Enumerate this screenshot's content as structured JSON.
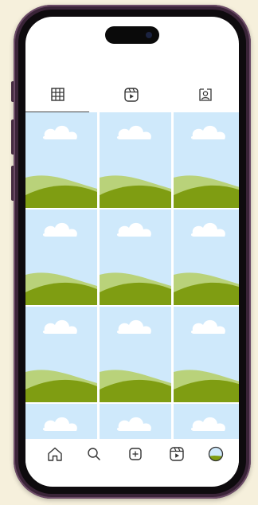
{
  "app": {
    "name": "profile-grid"
  },
  "tabs": [
    {
      "id": "posts",
      "icon": "grid-icon",
      "active": true
    },
    {
      "id": "reels",
      "icon": "reels-icon",
      "active": false
    },
    {
      "id": "tagged",
      "icon": "tagged-person-icon",
      "active": false
    }
  ],
  "grid": {
    "columns": 3,
    "visible_rows": 3,
    "partial_row": true,
    "thumbnail": "landscape-placeholder-icon"
  },
  "bottom_nav": [
    {
      "id": "home",
      "icon": "home-icon"
    },
    {
      "id": "search",
      "icon": "search-icon"
    },
    {
      "id": "create",
      "icon": "add-post-icon"
    },
    {
      "id": "reels",
      "icon": "reels-icon"
    },
    {
      "id": "profile",
      "icon": "avatar-icon"
    }
  ],
  "colors": {
    "background": "#f6f0dc",
    "frame": "#3a2438",
    "sky": "#cfe9fb",
    "hill_dark": "#7f9d12",
    "hill_light": "#b9d27a",
    "cloud": "#ffffff"
  }
}
